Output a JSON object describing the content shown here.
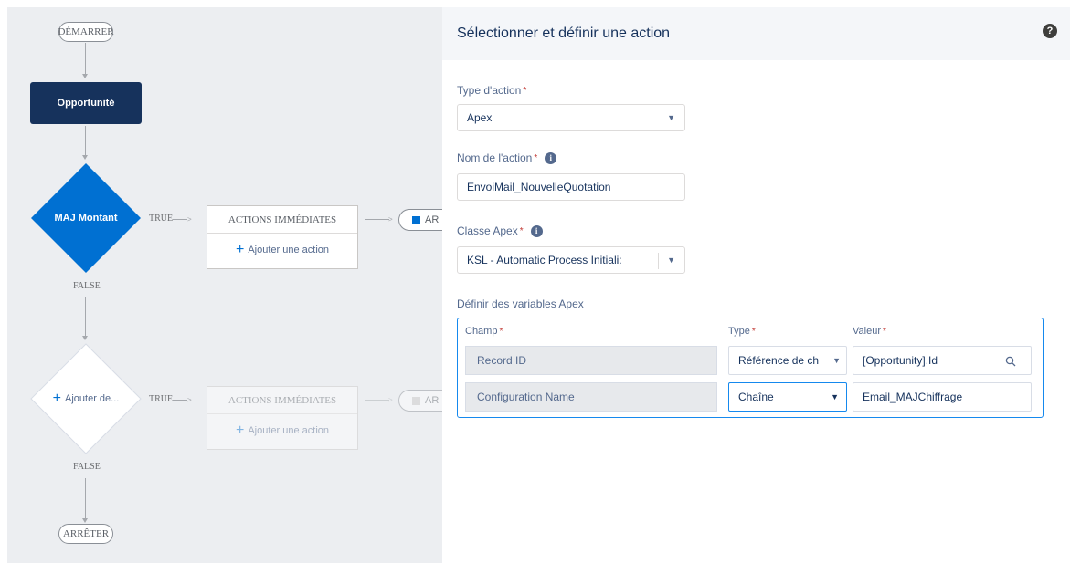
{
  "canvas": {
    "start_label": "DÉMARRER",
    "stop_label": "ARRÊTER",
    "object_node": "Opportunité",
    "criteria1": {
      "label": "MAJ Montant",
      "true_label": "TRUE",
      "false_label": "FALSE",
      "actions_header": "ACTIONS IMMÉDIATES",
      "add_action": "Ajouter une action",
      "scheduled_partial": "AR"
    },
    "criteria2": {
      "label": "Ajouter de...",
      "true_label": "TRUE",
      "false_label": "FALSE",
      "actions_header": "ACTIONS IMMÉDIATES",
      "add_action": "Ajouter une action",
      "scheduled_partial": "AR"
    }
  },
  "panel": {
    "title": "Sélectionner et définir une action",
    "action_type_label": "Type d'action",
    "action_type_value": "Apex",
    "action_name_label": "Nom de l'action",
    "action_name_value": "EnvoiMail_NouvelleQuotation",
    "apex_class_label": "Classe Apex",
    "apex_class_value": "KSL - Automatic Process Initiali:",
    "vars_label": "Définir des variables Apex",
    "columns": {
      "field": "Champ",
      "type": "Type",
      "value": "Valeur"
    },
    "rows": [
      {
        "field": "Record ID",
        "type": "Référence de ch",
        "value": "[Opportunity].Id"
      },
      {
        "field": "Configuration Name",
        "type": "Chaîne",
        "value": "Email_MAJChiffrage"
      }
    ],
    "required_mark": "*"
  },
  "icons": {
    "help": "question-circle-icon",
    "info": "info-icon",
    "search": "search-icon",
    "dropdown": "chevron-down-icon",
    "plus": "plus-icon"
  },
  "colors": {
    "decision": "#0070d2",
    "object_node": "#16325c",
    "focus_border": "#1589ee"
  }
}
